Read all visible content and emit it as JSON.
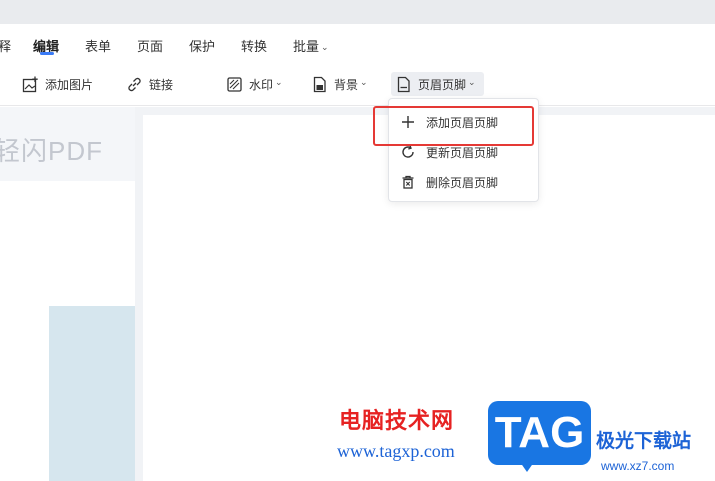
{
  "menu": {
    "items": [
      {
        "label": "释",
        "active": false
      },
      {
        "label": "编辑",
        "active": true
      },
      {
        "label": "表单",
        "active": false
      },
      {
        "label": "页面",
        "active": false
      },
      {
        "label": "保护",
        "active": false
      },
      {
        "label": "转换",
        "active": false
      },
      {
        "label": "批量",
        "active": false
      }
    ],
    "accent_color": "#3a7bf6"
  },
  "toolbar": {
    "add_image": {
      "label": "添加图片",
      "icon": "add-image-icon"
    },
    "link": {
      "label": "链接",
      "icon": "link-icon"
    },
    "watermark": {
      "label": "水印",
      "icon": "watermark-icon"
    },
    "background": {
      "label": "背景",
      "icon": "background-icon"
    },
    "header_footer": {
      "label": "页眉页脚",
      "icon": "header-footer-icon"
    }
  },
  "left_pane": {
    "brand": "轻闪PDF"
  },
  "dropdown": {
    "items": [
      {
        "label": "添加页眉页脚",
        "icon": "plus-icon"
      },
      {
        "label": "更新页眉页脚",
        "icon": "refresh-icon"
      },
      {
        "label": "删除页眉页脚",
        "icon": "trash-icon"
      }
    ],
    "highlight_color": "#e53935"
  },
  "watermark_overlay": {
    "site_cn": "电脑技术网",
    "site_url": "www.tagxp.com",
    "tag": "TAG",
    "site2_cn": "极光下载站",
    "site2_url": "www.xz7.com"
  }
}
